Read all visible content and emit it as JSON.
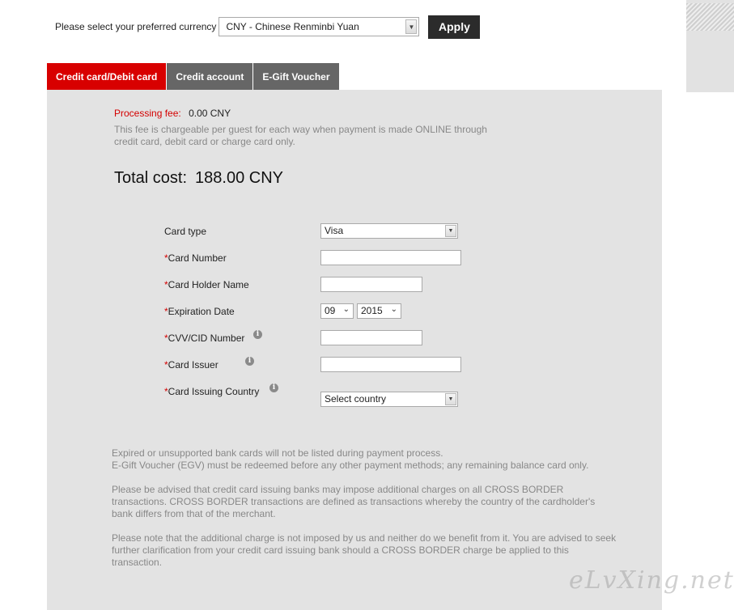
{
  "currency": {
    "label": "Please select your preferred currency",
    "selected": "CNY - Chinese Renminbi Yuan",
    "apply_label": "Apply"
  },
  "tabs": [
    {
      "label": "Credit card/Debit card",
      "active": true
    },
    {
      "label": "Credit account",
      "active": false
    },
    {
      "label": "E-Gift Voucher",
      "active": false
    }
  ],
  "fee": {
    "label": "Processing fee:",
    "value": "0.00 CNY",
    "note": "This fee is chargeable per guest for each way when payment is made ONLINE through credit card, debit card or charge card only."
  },
  "total": {
    "label": "Total cost:",
    "value": "188.00 CNY"
  },
  "form": {
    "card_type_label": "Card type",
    "card_type_value": "Visa",
    "card_number_label": "Card Number",
    "card_number_value": "",
    "holder_label": "Card Holder Name",
    "holder_value": "",
    "expiry_label": "Expiration Date",
    "expiry_month": "09",
    "expiry_year": "2015",
    "cvv_label": "CVV/CID Number",
    "cvv_value": "",
    "issuer_label": "Card Issuer",
    "issuer_value": "",
    "country_label": "Card Issuing Country",
    "country_value": "Select country",
    "required_mark": "*"
  },
  "notes": {
    "line1": "Expired or unsupported bank cards will not be listed during payment process.",
    "line2": "E-Gift Voucher (EGV) must be redeemed before any other payment methods; any remaining balance card only.",
    "para2": "Please be advised that credit card issuing banks may impose additional charges on all CROSS BORDER transactions. CROSS BORDER transactions are defined as transactions whereby the country of the cardholder's bank differs from that of the merchant.",
    "para3": "Please note that the additional charge is not imposed by us and neither do we benefit from it. You are advised to seek further clarification from your credit card issuing bank should a CROSS BORDER charge be applied to this transaction."
  },
  "watermark": "eLvXing.net",
  "icons": {
    "info": "info-icon",
    "dropdown": "chevron-down-icon"
  },
  "colors": {
    "accent": "#d80000",
    "tab_inactive": "#666666",
    "panel_bg": "#e3e3e3",
    "apply_bg": "#2b2b2b"
  }
}
